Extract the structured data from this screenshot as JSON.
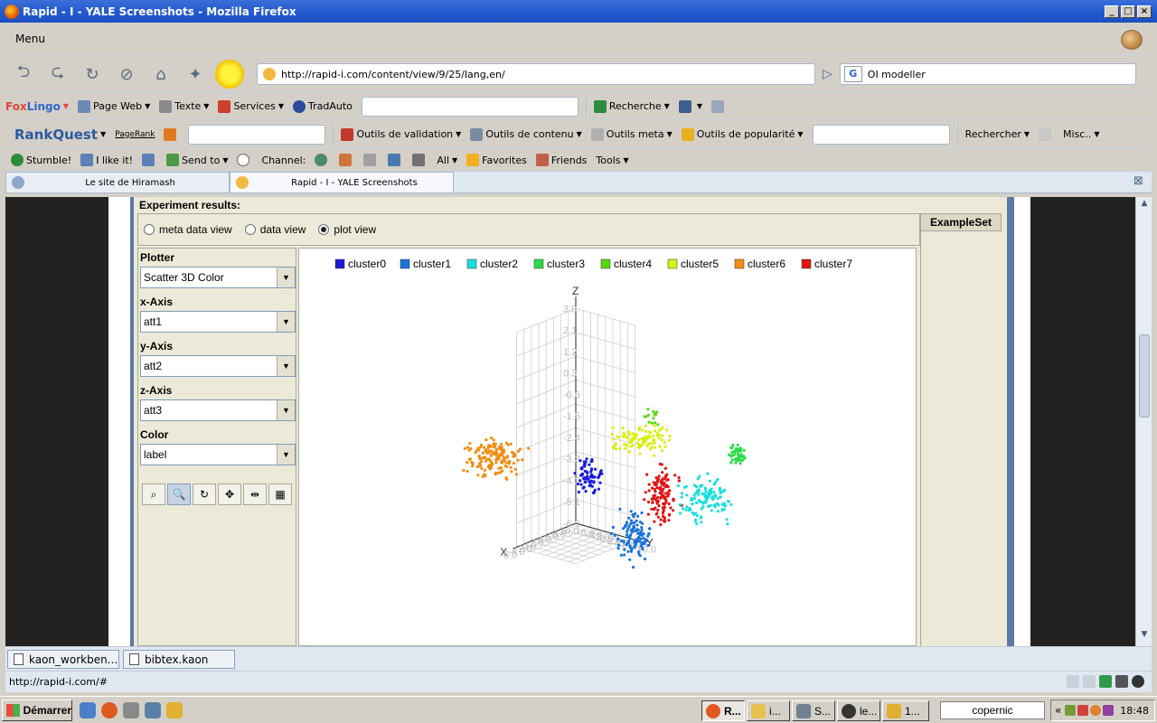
{
  "window": {
    "title": "Rapid - I - YALE Screenshots - Mozilla Firefox",
    "min": "_",
    "max": "□",
    "close": "×"
  },
  "menubar": {
    "menu_label": "Menu"
  },
  "nav": {
    "url": "http://rapid-i.com/content/view/9/25/lang,en/",
    "search_engine": "G",
    "search_text": "OI modeller"
  },
  "foxlingo": {
    "brand_a": "Fox",
    "brand_b": "Lingo",
    "items": [
      "Page Web",
      "Texte",
      "Services",
      "TradAuto"
    ],
    "recherche": "Recherche"
  },
  "rankquest": {
    "brand": "RankQuest",
    "pagerank": "PageRank",
    "items": [
      "Outils de validation",
      "Outils de contenu",
      "Outils meta",
      "Outils de popularité"
    ],
    "rechercher": "Rechercher",
    "misc": "Misc.."
  },
  "stumble": {
    "stumble": "Stumble!",
    "like": "I like it!",
    "send": "Send to",
    "channel": "Channel:",
    "all": "All",
    "favorites": "Favorites",
    "friends": "Friends",
    "tools": "Tools"
  },
  "tabs": [
    {
      "label": "Le site de Hiramash"
    },
    {
      "label": "Rapid - I - YALE Screenshots"
    }
  ],
  "yale": {
    "results_title": "Experiment results:",
    "views": [
      "meta data view",
      "data view",
      "plot view"
    ],
    "selected_view": "plot view",
    "exampleset_tab": "ExampleSet",
    "plotter_label": "Plotter",
    "plotter_value": "Scatter 3D Color",
    "xaxis_label": "x-Axis",
    "xaxis_value": "att1",
    "yaxis_label": "y-Axis",
    "yaxis_value": "att2",
    "zaxis_label": "z-Axis",
    "zaxis_value": "att3",
    "color_label": "Color",
    "color_value": "label"
  },
  "chart_data": {
    "type": "scatter",
    "legend_position": "top",
    "series": [
      {
        "name": "cluster0",
        "color": "#1a1adb"
      },
      {
        "name": "cluster1",
        "color": "#1a73d9"
      },
      {
        "name": "cluster2",
        "color": "#19dede"
      },
      {
        "name": "cluster3",
        "color": "#2bdc4a"
      },
      {
        "name": "cluster4",
        "color": "#5ad90f"
      },
      {
        "name": "cluster5",
        "color": "#d9ef14"
      },
      {
        "name": "cluster6",
        "color": "#f08d12"
      },
      {
        "name": "cluster7",
        "color": "#e01515"
      }
    ],
    "axes": {
      "x": "X",
      "y": "Y",
      "z": "Z"
    },
    "z_ticks": [
      "3.0",
      "2.1",
      "1.2",
      "0.3",
      "-0.6",
      "-1.5",
      "-2.4",
      "-3.3",
      "-4.2",
      "-5.1",
      "-6.0"
    ],
    "x_ticks": [
      "-6.0",
      "-4.0",
      "-2.0",
      "0.0",
      "2.0",
      "4.0",
      "6.0",
      "8.0",
      "10.0"
    ],
    "y_ticks": [
      "-6.0",
      "-4.0",
      "-2.0",
      "0.0",
      "2.0",
      "4.0",
      "6.0",
      "8.0",
      "10.0"
    ]
  },
  "bottom": {
    "tab1": "kaon_workben...",
    "tab2": "bibtex.kaon"
  },
  "status": {
    "url": "http://rapid-i.com/#"
  },
  "taskbar": {
    "start": "Démarrer",
    "buttons": [
      "R...",
      "i...",
      "S...",
      "le...",
      "1..."
    ],
    "deskbar": "copernic",
    "tray_chevron": "«",
    "time": "18:48"
  }
}
